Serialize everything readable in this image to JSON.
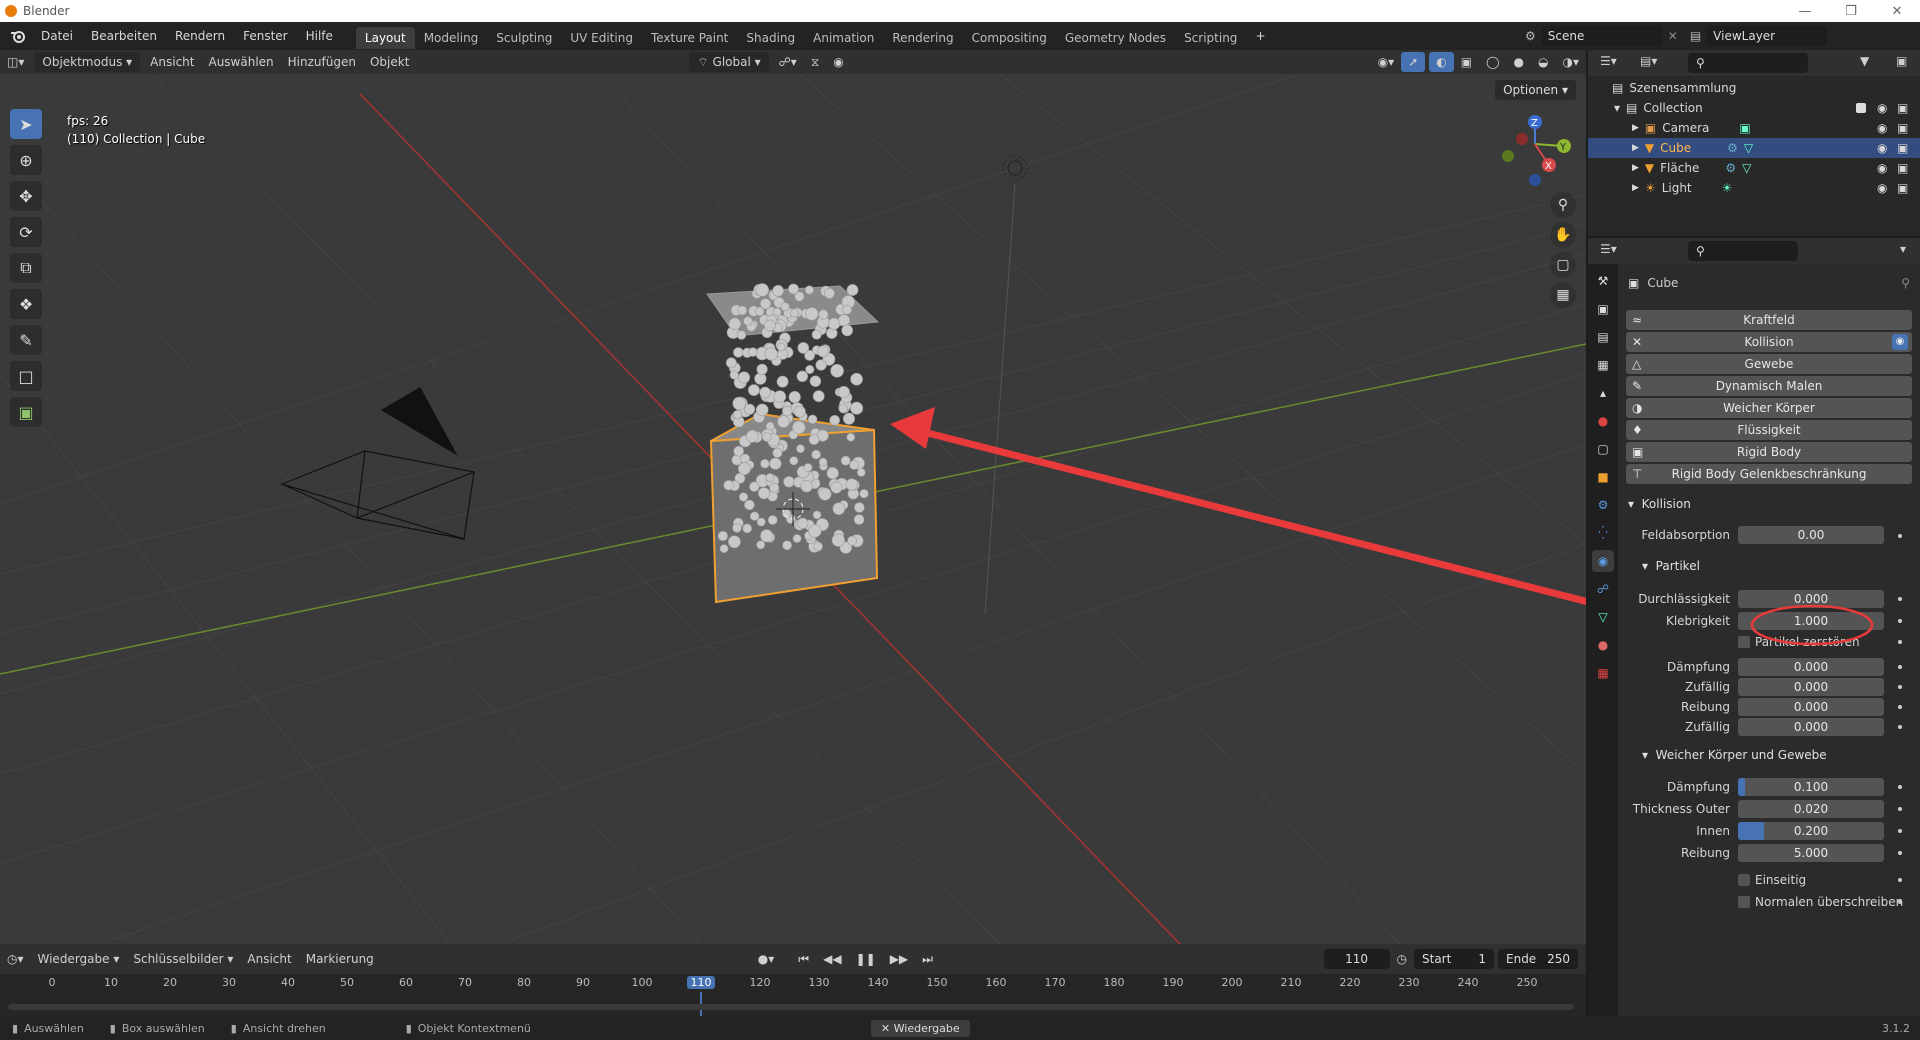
{
  "window": {
    "title": "Blender"
  },
  "menu": [
    "Datei",
    "Bearbeiten",
    "Rendern",
    "Fenster",
    "Hilfe"
  ],
  "workspaces": [
    "Layout",
    "Modeling",
    "Sculpting",
    "UV Editing",
    "Texture Paint",
    "Shading",
    "Animation",
    "Rendering",
    "Compositing",
    "Geometry Nodes",
    "Scripting"
  ],
  "active_workspace": "Layout",
  "scene": "Scene",
  "view_layer": "ViewLayer",
  "viewport_header": {
    "mode": "Objektmodus",
    "menus": [
      "Ansicht",
      "Auswählen",
      "Hinzufügen",
      "Objekt"
    ],
    "orientation": "Global",
    "options": "Optionen"
  },
  "viewport": {
    "fps": "fps: 26",
    "context": "(110) Collection | Cube"
  },
  "outliner": {
    "root": "Szenensammlung",
    "collection": "Collection",
    "items": [
      "Camera",
      "Cube",
      "Fläche",
      "Light"
    ],
    "selected": "Cube"
  },
  "properties": {
    "object_name": "Cube",
    "physics_buttons": [
      "Kraftfeld",
      "Kollision",
      "Gewebe",
      "Dynamisch Malen",
      "Weicher Körper",
      "Flüssigkeit",
      "Rigid Body",
      "Rigid Body Gelenkbeschränkung"
    ],
    "collision_section": "Kollision",
    "feldabsorption": {
      "label": "Feldabsorption",
      "value": "0.00"
    },
    "partikel_section": "Partikel",
    "partikel": [
      {
        "label": "Durchlässigkeit",
        "value": "0.000"
      },
      {
        "label": "Klebrigkeit",
        "value": "1.000"
      }
    ],
    "partikel_zerstoeren": "Partikel zerstören",
    "partikel2": [
      {
        "label": "Dämpfung",
        "value": "0.000"
      },
      {
        "label": "Zufällig",
        "value": "0.000"
      },
      {
        "label": "Reibung",
        "value": "0.000"
      },
      {
        "label": "Zufällig",
        "value": "0.000"
      }
    ],
    "softbody_section": "Weicher Körper und Gewebe",
    "softbody": [
      {
        "label": "Dämpfung",
        "value": "0.100",
        "fill": 0.05
      },
      {
        "label": "Thickness Outer",
        "value": "0.020",
        "fill": 0
      },
      {
        "label": "Innen",
        "value": "0.200",
        "fill": 0.18
      },
      {
        "label": "Reibung",
        "value": "5.000",
        "fill": 0
      }
    ],
    "einseitig": "Einseitig",
    "normalen": "Normalen überschreiben"
  },
  "timeline": {
    "menus": [
      "Wiedergabe",
      "Schlüsselbilder",
      "Ansicht",
      "Markierung"
    ],
    "current_frame": "110",
    "start_label": "Start",
    "start": "1",
    "end_label": "Ende",
    "end": "250",
    "ticks": [
      "0",
      "10",
      "20",
      "30",
      "40",
      "50",
      "60",
      "70",
      "80",
      "90",
      "100",
      "110",
      "120",
      "130",
      "140",
      "150",
      "160",
      "170",
      "180",
      "190",
      "200",
      "210",
      "220",
      "230",
      "240",
      "250"
    ]
  },
  "statusbar": {
    "items": [
      "Auswählen",
      "Box auswählen",
      "Ansicht drehen",
      "Objekt Kontextmenü"
    ],
    "playback": "Wiedergabe",
    "version": "3.1.2"
  },
  "colors": {
    "accent": "#4772b3",
    "selected_row": "#334d80",
    "annotation": "#e83a3a",
    "object_outline": "#f0a030"
  }
}
